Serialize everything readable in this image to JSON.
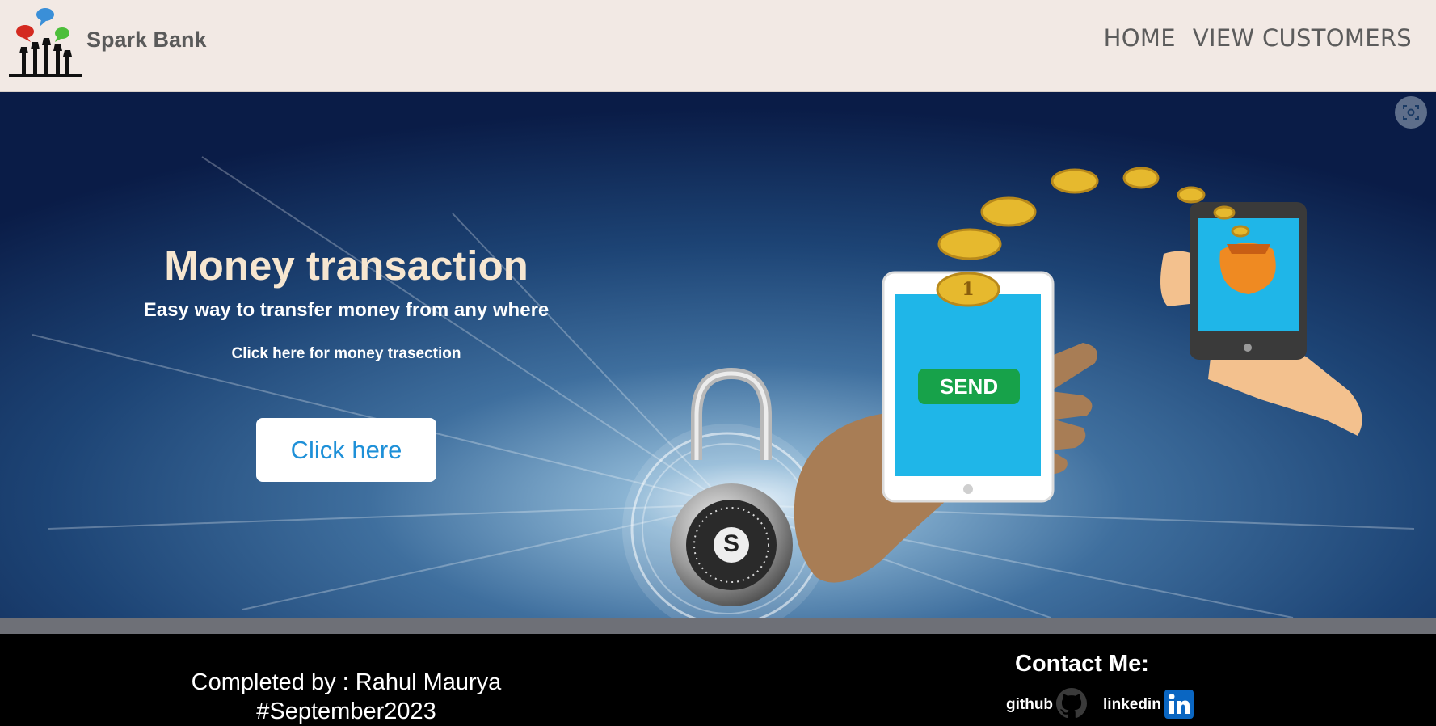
{
  "header": {
    "brand": "Spark Bank",
    "nav": [
      {
        "label": "HOME"
      },
      {
        "label": "VIEW CUSTOMERS"
      }
    ]
  },
  "hero": {
    "title": "Money transaction",
    "subtitle": "Easy way to transfer money from any where",
    "hint": "Click here for money trasection",
    "cta_label": "Click here",
    "phone_button_label": "SEND",
    "coin_label": "1",
    "lock_label": "S"
  },
  "footer": {
    "credit_line1": "Completed by : Rahul Maurya",
    "credit_line2": "#September2023",
    "contact_title": "Contact Me:",
    "github_label": "github",
    "linkedin_label": "linkedin"
  },
  "icons": {
    "logo": "hands-speech-bubbles-logo",
    "screenshot": "screenshot-capture-icon",
    "github": "github-icon",
    "linkedin": "linkedin-icon"
  },
  "colors": {
    "header_bg": "#f2e9e4",
    "nav_text": "#5c5c5c",
    "hero_title": "#f6e6d0",
    "cta_text": "#1e90d8",
    "send_button": "#17a24a",
    "phone_screen": "#1fb6e8",
    "coin": "#e6b92e",
    "footer_bg": "#000000",
    "linkedin_blue": "#0a66c2"
  }
}
